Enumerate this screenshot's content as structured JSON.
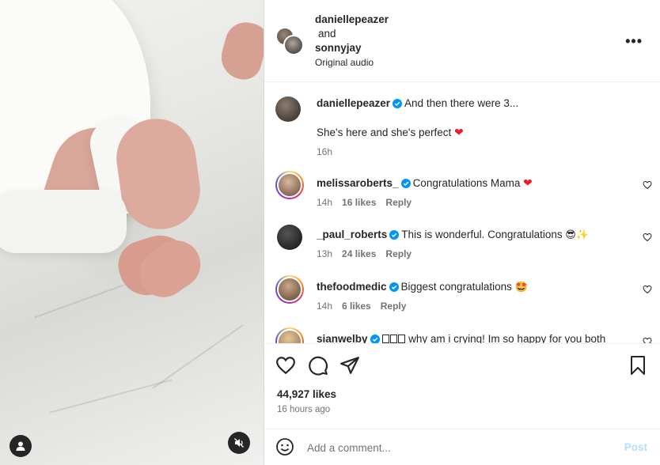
{
  "header": {
    "user1": "daniellepeazer",
    "and_text": "and",
    "user2": "sonnyjay",
    "audio": "Original audio"
  },
  "caption": {
    "username": "daniellepeazer",
    "text": "And then there were 3...",
    "line2": "She's here and she's perfect",
    "time": "16h"
  },
  "comments": [
    {
      "username": "melissaroberts_",
      "text": "Congratulations Mama",
      "time": "14h",
      "likes": "16 likes",
      "reply": "Reply"
    },
    {
      "username": "_paul_roberts",
      "text": "This is wonderful. Congratulations",
      "time": "13h",
      "likes": "24 likes",
      "reply": "Reply"
    },
    {
      "username": "thefoodmedic",
      "text": "Biggest congratulations",
      "time": "14h",
      "likes": "6 likes",
      "reply": "Reply"
    },
    {
      "username": "sianwelby",
      "text": "why am i crying! Im so happy for you both"
    }
  ],
  "stats": {
    "likes": "44,927 likes",
    "time_ago": "16 hours ago"
  },
  "composer": {
    "placeholder": "Add a comment...",
    "post_label": "Post"
  },
  "icons": {
    "more": "more-options-icon",
    "heart": "heart-icon",
    "comment": "comment-icon",
    "share": "share-icon",
    "save": "bookmark-icon",
    "emoji": "emoji-icon",
    "user": "user-tag-icon",
    "mute": "muted-speaker-icon"
  },
  "colors": {
    "verified": "#0095f6",
    "heart_emoji": "#ed1c24",
    "post_disabled": "#b2dffc",
    "secondary_text": "#737373"
  }
}
